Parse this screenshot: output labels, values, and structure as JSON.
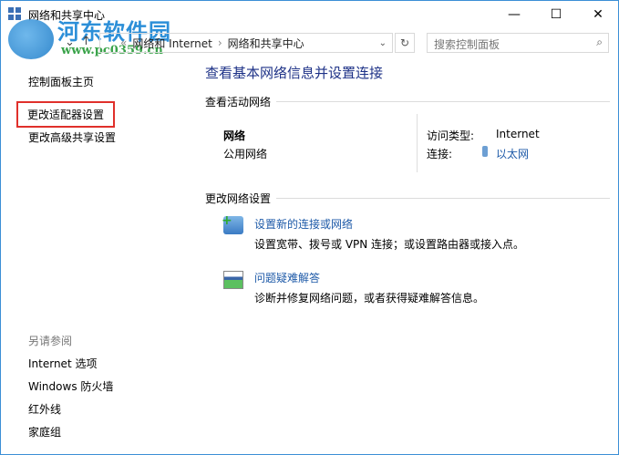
{
  "window": {
    "title": "网络和共享中心",
    "minimize": "—",
    "maximize": "☐",
    "close": "✕"
  },
  "watermark": {
    "name": "河东软件园",
    "url": "www.pc0359.cn"
  },
  "nav": {
    "back": "←",
    "forward": "→",
    "recent": "⌄",
    "up": "↑",
    "breadcrumb": [
      "«",
      "网络和 Internet",
      "网络和共享中心"
    ],
    "separator": "›",
    "dropdown": "⌄",
    "refresh": "↻",
    "search_placeholder": "搜索控制面板",
    "search_icon": "⌕"
  },
  "sidebar": {
    "home": "控制面板主页",
    "items": [
      "更改适配器设置",
      "更改高级共享设置"
    ],
    "see_also": "另请参阅",
    "links": [
      "Internet 选项",
      "Windows 防火墙",
      "红外线",
      "家庭组"
    ]
  },
  "main": {
    "title": "查看基本网络信息并设置连接",
    "active_section": "查看活动网络",
    "network_name": "网络",
    "network_type": "公用网络",
    "access_label": "访问类型:",
    "access_value": "Internet",
    "conn_label": "连接:",
    "conn_value": "以太网",
    "change_section": "更改网络设置",
    "tasks": [
      {
        "title": "设置新的连接或网络",
        "desc": "设置宽带、拨号或 VPN 连接；或设置路由器或接入点。"
      },
      {
        "title": "问题疑难解答",
        "desc": "诊断并修复网络问题，或者获得疑难解答信息。"
      }
    ]
  }
}
